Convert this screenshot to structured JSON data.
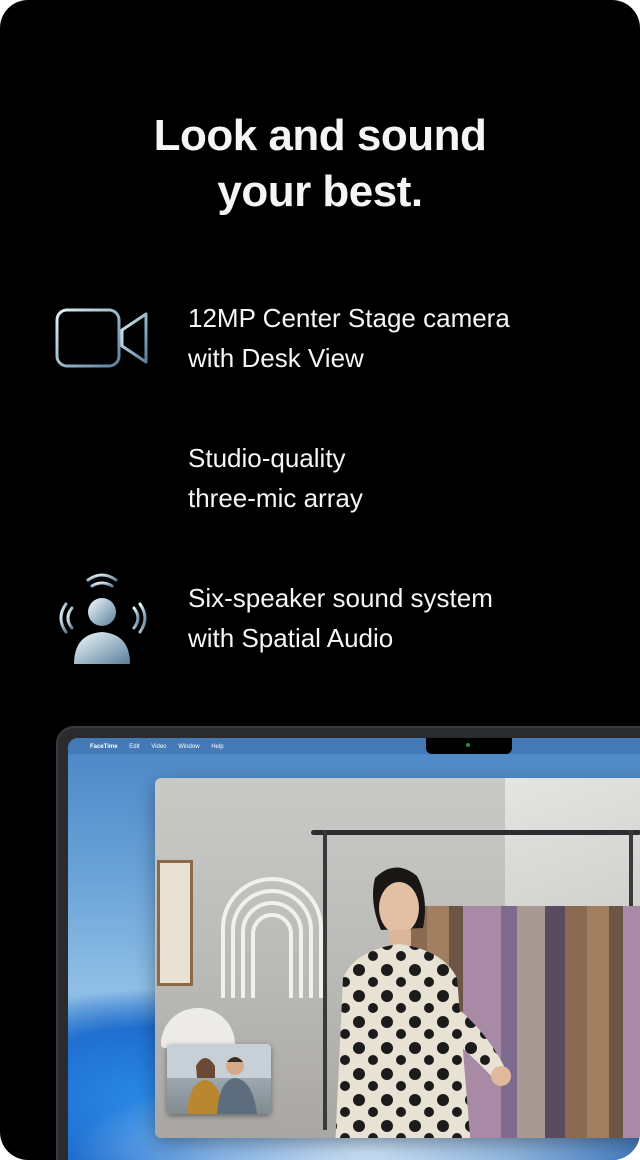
{
  "headline": {
    "line1": "Look and sound",
    "line2": "your best."
  },
  "features": [
    {
      "icon": "video-camera-icon",
      "line1": "12MP Center Stage camera",
      "line2": "with Desk View"
    },
    {
      "icon": "microphone-waveform-icon",
      "line1": "Studio-quality",
      "line2": "three-mic array"
    },
    {
      "icon": "spatial-audio-speaker-icon",
      "line1": "Six-speaker sound system",
      "line2": "with Spatial Audio"
    }
  ],
  "laptop": {
    "menubar": {
      "app_name": "FaceTime",
      "items": [
        "Edit",
        "Video",
        "Window",
        "Help"
      ]
    }
  },
  "colors": {
    "background": "#000000",
    "text": "#f5f5f7",
    "icon_gradient_start": "#ffffff",
    "icon_gradient_end": "#5a7f9c"
  }
}
